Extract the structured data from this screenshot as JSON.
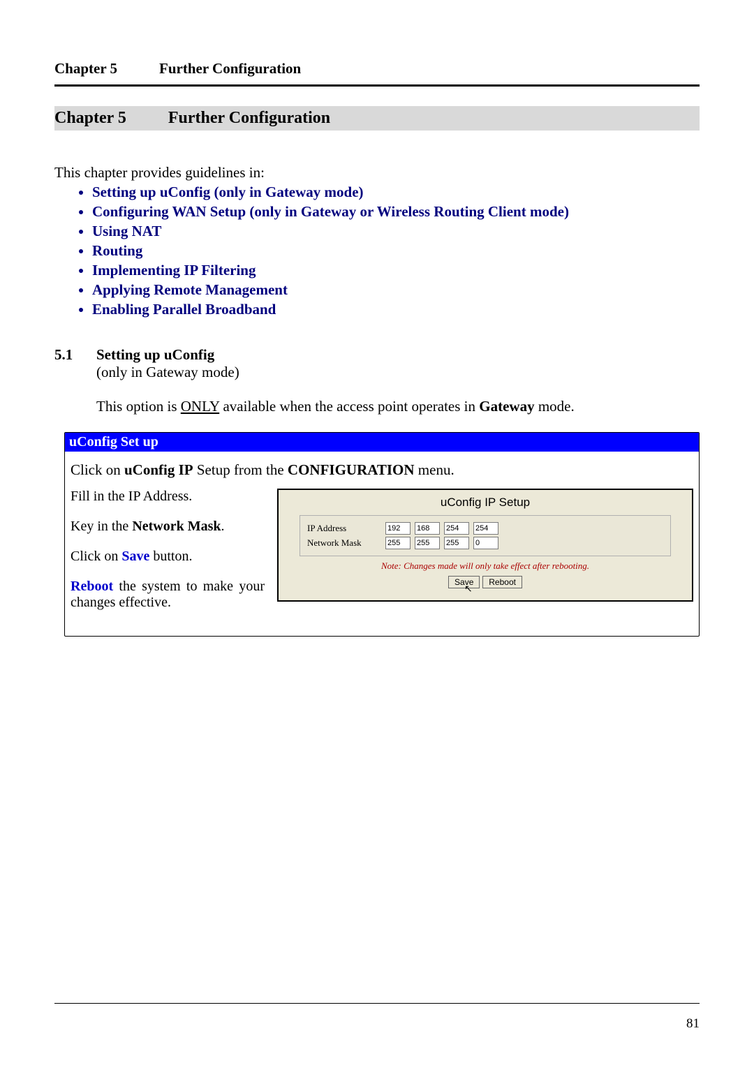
{
  "header": {
    "chapter_label": "Chapter 5",
    "chapter_title": "Further Configuration"
  },
  "chapter_bar": {
    "label": "Chapter 5",
    "title": "Further Configuration"
  },
  "intro": "This chapter provides guidelines in:",
  "topics": [
    "Setting up uConfig (only in Gateway mode)",
    "Configuring WAN Setup (only in Gateway or Wireless Routing Client mode)",
    "Using NAT",
    "Routing",
    "Implementing IP Filtering",
    "Applying Remote Management",
    "Enabling Parallel Broadband"
  ],
  "section": {
    "number": "5.1",
    "title": "Setting up uConfig",
    "subnote": "(only in Gateway mode)",
    "body_pre": "This option is ",
    "body_only": "ONLY",
    "body_mid": " available when the access point operates in ",
    "body_bold": "Gateway",
    "body_post": " mode."
  },
  "box": {
    "header": "uConfig Set up",
    "line1_pre": "Click on ",
    "line1_b1": "uConfig IP",
    "line1_mid": " Setup from the ",
    "line1_b2": "CONFIGURATION",
    "line1_post": " menu.",
    "left": {
      "p1": "Fill in the IP Address.",
      "p2_pre": "Key in the ",
      "p2_bold": "Network Mask",
      "p2_post": ".",
      "p3_pre": "Click on ",
      "p3_save": "Save",
      "p3_post": " button.",
      "p4_reboot": "Reboot",
      "p4_rest": " the system to make your changes effective."
    },
    "shot": {
      "title": "uConfig IP Setup",
      "labels": {
        "ip": "IP Address",
        "mask": "Network Mask"
      },
      "ip": [
        "192",
        "168",
        "254",
        "254"
      ],
      "mask": [
        "255",
        "255",
        "255",
        "0"
      ],
      "note": "Note: Changes made will only take effect after rebooting.",
      "buttons": {
        "save": "Save",
        "reboot": "Reboot"
      }
    }
  },
  "page_number": "81"
}
